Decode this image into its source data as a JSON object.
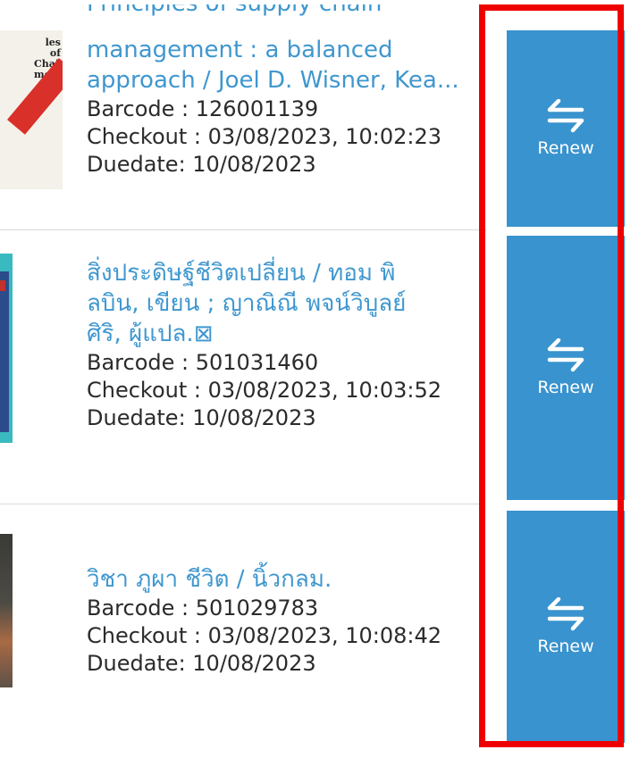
{
  "loans": [
    {
      "title_partial_top": "Principles of supply chain",
      "title_lines": [
        "management : a balanced",
        "approach / Joel D. Wisner, Kea..."
      ],
      "barcode": "Barcode : 126001139",
      "checkout": "Checkout : 03/08/2023, 10:02:23",
      "duedate": "Duedate: 10/08/2023",
      "cover_text": "les of Chain ment",
      "renew_label": "Renew"
    },
    {
      "title_lines": [
        "สิ่งประดิษฐ์ชีวิตเปลี่ยน / ทอม พิ",
        "ลบิน, เขียน ; ญาณิณี พจน์วิบูลย์",
        "ศิริ, ผู้แปล.⊠"
      ],
      "barcode": "Barcode : 501031460",
      "checkout": "Checkout : 03/08/2023, 10:03:52",
      "duedate": "Duedate: 10/08/2023",
      "renew_label": "Renew"
    },
    {
      "title_lines": [
        "วิชา ภูผา ชีวิต / นิ้วกลม."
      ],
      "barcode": "Barcode : 501029783",
      "checkout": "Checkout : 03/08/2023, 10:08:42",
      "duedate": "Duedate: 10/08/2023",
      "renew_label": "Renew"
    }
  ],
  "icons": {
    "renew": "swap-arrows-icon"
  },
  "colors": {
    "link": "#3f97cf",
    "renew_bg": "#3993ce",
    "highlight": "#ee0000",
    "text": "#2b2b2b"
  }
}
